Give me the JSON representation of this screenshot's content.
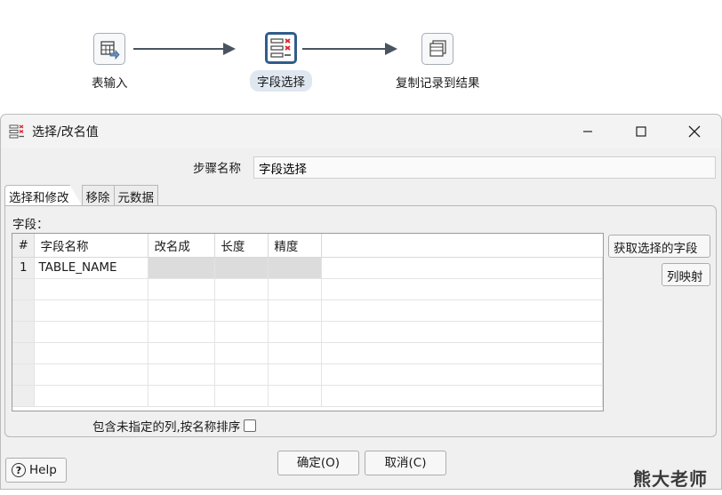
{
  "canvas": {
    "steps": [
      {
        "label": "表输入",
        "icon": "table-input-icon"
      },
      {
        "label": "字段选择",
        "icon": "select-values-icon",
        "selected": true
      },
      {
        "label": "复制记录到结果",
        "icon": "copy-rows-to-result-icon"
      }
    ]
  },
  "dialog": {
    "title": "选择/改名值",
    "window_controls": {
      "minimize": "—",
      "maximize": "☐",
      "close": "✕"
    },
    "step_name_label": "步骤名称",
    "step_name_value": "字段选择",
    "tabs": [
      "选择和修改",
      "移除",
      "元数据"
    ],
    "fields_label": "字段：",
    "table": {
      "headers": [
        "#",
        "字段名称",
        "改名成",
        "长度",
        "精度"
      ],
      "rows": [
        [
          "1",
          "TABLE_NAME",
          "",
          "",
          ""
        ]
      ]
    },
    "get_fields_button": "获取选择的字段",
    "column_mapping_button": "列映射",
    "include_unspecified_label": "包含未指定的列,按名称排序",
    "include_unspecified_checked": false,
    "help_button": "Help",
    "ok_button": "确定(O)",
    "cancel_button": "取消(C)"
  },
  "watermark": "熊大老师",
  "colors": {
    "selected_border": "#2f5d8c",
    "delete_red": "#d9262c",
    "hop": "#4a5360"
  }
}
